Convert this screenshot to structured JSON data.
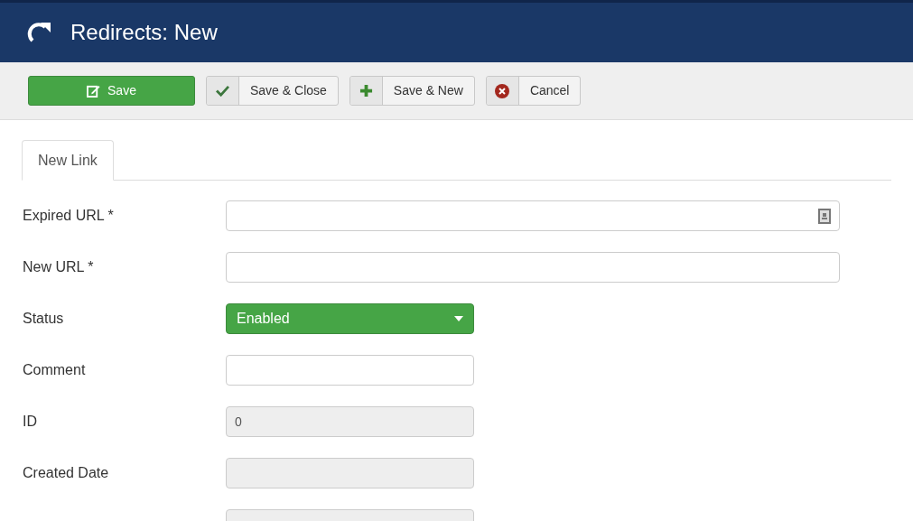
{
  "header": {
    "title": "Redirects: New"
  },
  "toolbar": [
    {
      "label": "Save",
      "kind": "primary"
    },
    {
      "label": "Save & Close",
      "kind": "secondary"
    },
    {
      "label": "Save & New",
      "kind": "secondary"
    },
    {
      "label": "Cancel",
      "kind": "secondary"
    }
  ],
  "tabs": [
    {
      "label": "New Link",
      "selected": true
    }
  ],
  "fields": [
    {
      "label": "Expired URL *",
      "kind": "url"
    },
    {
      "label": "New URL *",
      "kind": "long"
    },
    {
      "label": "Status",
      "kind": "select",
      "value": "Enabled"
    },
    {
      "label": "Comment",
      "kind": "short"
    },
    {
      "label": "ID",
      "kind": "readonly",
      "value": "0"
    },
    {
      "label": "Created Date",
      "kind": "readonly"
    },
    {
      "kind": "readonly"
    }
  ]
}
